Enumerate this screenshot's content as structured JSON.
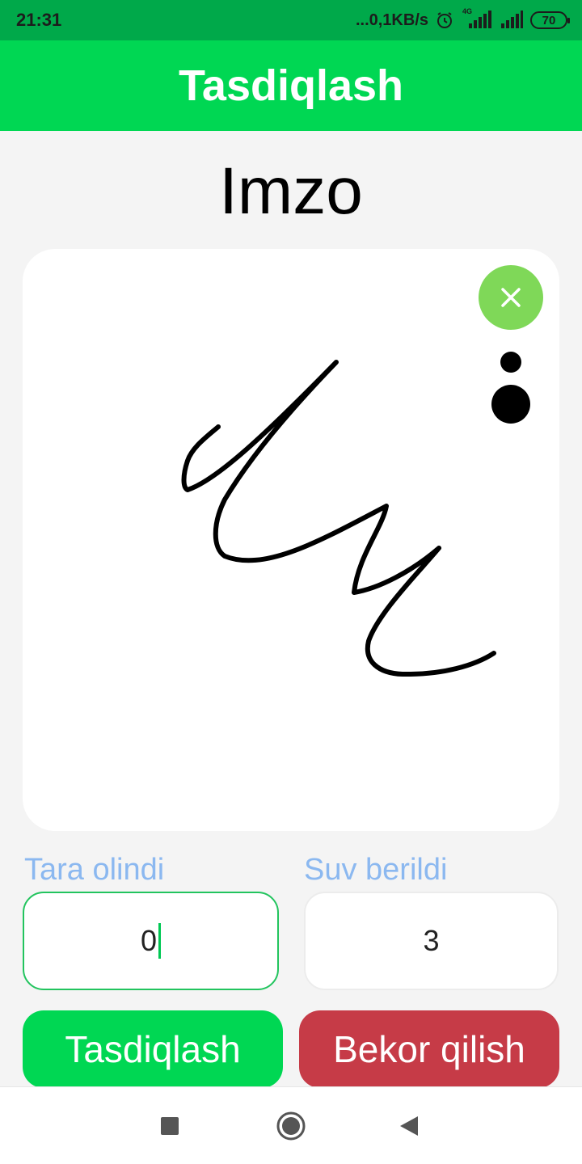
{
  "status_bar": {
    "time": "21:31",
    "network_speed": "...0,1KB/s",
    "network_type": "4G",
    "battery": "70",
    "icons": [
      "alarm-icon",
      "signal-icon",
      "signal-icon",
      "battery-icon"
    ]
  },
  "app_bar": {
    "title": "Tasdiqlash"
  },
  "page": {
    "title": "Imzo"
  },
  "signature_pad": {
    "icons": [
      "close-icon",
      "pen-size-small-icon",
      "pen-size-large-icon"
    ]
  },
  "form": {
    "tara": {
      "label": "Tara olindi",
      "value": "0"
    },
    "suv": {
      "label": "Suv berildi",
      "value": "3"
    }
  },
  "actions": {
    "confirm_label": "Tasdiqlash",
    "cancel_label": "Bekor qilish"
  },
  "nav_bar": {
    "icons": [
      "recents-icon",
      "home-icon",
      "back-icon"
    ]
  },
  "colors": {
    "status_bar": "#00a94a",
    "app_bar": "#00d753",
    "clear_button": "#7fd858",
    "label": "#8bb8f0",
    "focused_border": "#22c45e",
    "confirm": "#00d753",
    "cancel": "#c63b47",
    "background": "#f4f4f4"
  }
}
